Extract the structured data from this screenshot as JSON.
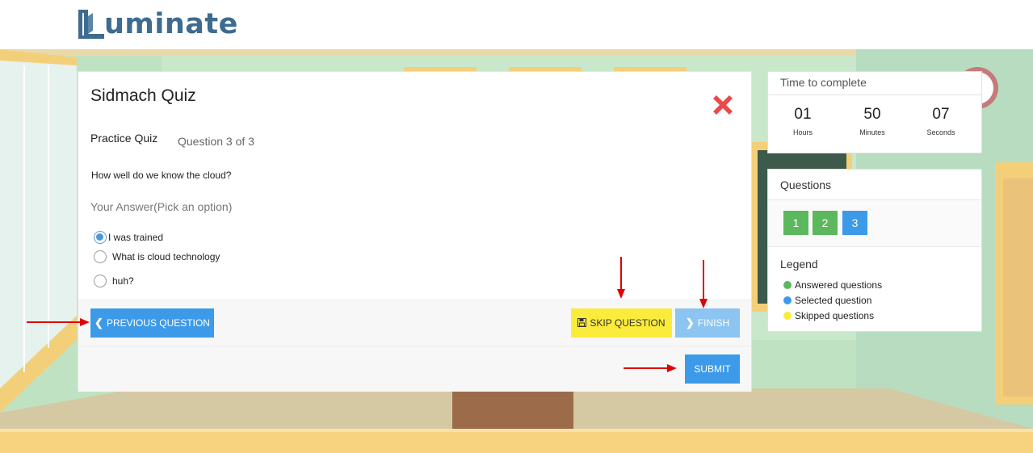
{
  "brand": {
    "logo_text": "uminate"
  },
  "quiz": {
    "title": "Sidmach Quiz",
    "type_label": "Practice Quiz",
    "progress_label": "Question 3 of 3",
    "question": "How well do we know the cloud?",
    "answer_prompt": "Your Answer",
    "answer_hint": "(Pick an option)",
    "options": [
      {
        "label": "I was trained",
        "selected": true
      },
      {
        "label": "What is cloud technology",
        "selected": false
      },
      {
        "label": "huh?",
        "selected": false
      }
    ],
    "buttons": {
      "previous": "PREVIOUS QUESTION",
      "skip": "SKIP QUESTION",
      "finish": "FINISH",
      "submit": "SUBMIT"
    }
  },
  "timer": {
    "title": "Time to complete",
    "hours": "01",
    "hours_label": "Hours",
    "minutes": "50",
    "minutes_label": "Minutes",
    "seconds": "07",
    "seconds_label": "Seconds"
  },
  "questions_panel": {
    "title": "Questions",
    "items": [
      {
        "label": "1",
        "status": "answered"
      },
      {
        "label": "2",
        "status": "answered"
      },
      {
        "label": "3",
        "status": "selected"
      }
    ],
    "legend_title": "Legend",
    "legend": [
      {
        "label": "Answered questions",
        "color": "#5cb85c"
      },
      {
        "label": "Selected question",
        "color": "#3d9ae8"
      },
      {
        "label": "Skipped questions",
        "color": "#fbeb3b"
      }
    ]
  },
  "colors": {
    "primary": "#3d9ae8",
    "finish": "#8cc4f2",
    "skip": "#fbeb3b",
    "answered": "#5cb85c",
    "close": "#e94b4b",
    "annotation": "#e00000"
  }
}
